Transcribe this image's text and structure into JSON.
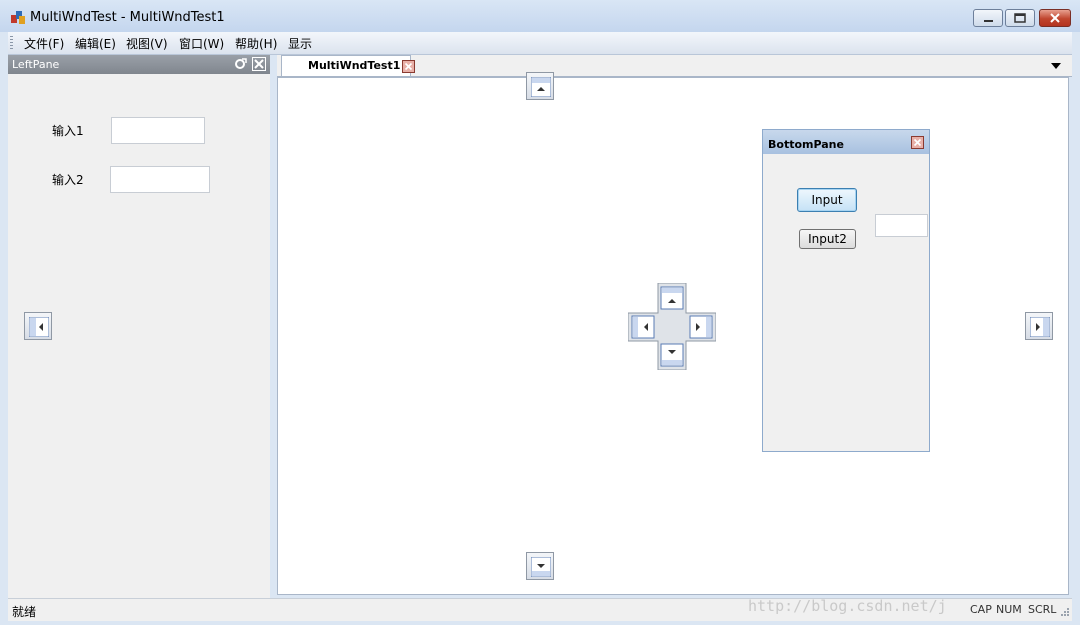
{
  "window": {
    "title": "MultiWndTest - MultiWndTest1"
  },
  "menu": [
    "文件(F)",
    "编辑(E)",
    "视图(V)",
    "窗口(W)",
    "帮助(H)",
    "显示"
  ],
  "left_pane": {
    "title": "LeftPane",
    "label1": "输入1",
    "label2": "输入2",
    "input1_value": "",
    "input2_value": ""
  },
  "tab": {
    "label": "MultiWndTest1"
  },
  "bottom_pane": {
    "title": "BottomPane",
    "button1": "Input",
    "button2": "Input2",
    "edit_value": ""
  },
  "status": {
    "text": "就绪",
    "cap": "CAP",
    "num": "NUM",
    "scrl": "SCRL"
  },
  "watermark": "http://blog.csdn.net/j",
  "colors": {
    "title_gradient_top": "#d9e6f5",
    "pane_caption": "#80868e",
    "bottom_caption": "#a8c1e0",
    "close_red": "#c0452e"
  }
}
